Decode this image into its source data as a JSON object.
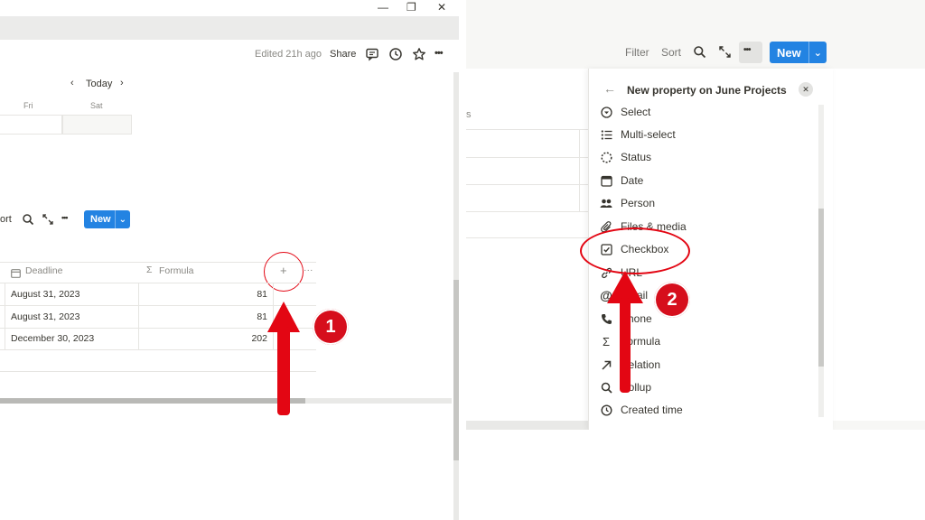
{
  "colors": {
    "accent_blue": "#2383e2",
    "annotation_red": "#e30613",
    "panel_bg": "#f7f7f5"
  },
  "left": {
    "window_controls": {
      "minimize": "—",
      "restore": "❐",
      "close": "✕"
    },
    "topbar": {
      "edited": "Edited 21h ago",
      "share": "Share",
      "icons": [
        "comment-icon",
        "clock-icon",
        "star-icon",
        "more-icon"
      ],
      "more": "•••"
    },
    "calendar": {
      "today": "Today",
      "prev": "‹",
      "next": "›",
      "days": [
        "Fri",
        "Sat"
      ]
    },
    "toolbar": {
      "sort_partial": "ort",
      "more": "•••",
      "new_label": "New",
      "chevron": "⌄"
    },
    "table": {
      "headers": {
        "deadline": "Deadline",
        "formula": "Formula",
        "formula_icon": "Σ",
        "add": "+",
        "more": "···"
      },
      "rows": [
        {
          "deadline": "August 31, 2023",
          "formula": "81"
        },
        {
          "deadline": "August 31, 2023",
          "formula": "81"
        },
        {
          "deadline": "December 30, 2023",
          "formula": "202"
        }
      ]
    },
    "annotation_number": "1"
  },
  "right": {
    "toolbar": {
      "filter": "Filter",
      "sort": "Sort",
      "more": "•••",
      "new_label": "New",
      "chevron": "⌄"
    },
    "partial_text": "s",
    "menu": {
      "back": "←",
      "title": "New property on June Projects",
      "close": "✕",
      "items": [
        {
          "label": "Select",
          "icon": "select-icon"
        },
        {
          "label": "Multi-select",
          "icon": "list-icon"
        },
        {
          "label": "Status",
          "icon": "status-icon"
        },
        {
          "label": "Date",
          "icon": "calendar-icon"
        },
        {
          "label": "Person",
          "icon": "person-icon"
        },
        {
          "label": "Files & media",
          "icon": "paperclip-icon"
        },
        {
          "label": "Checkbox",
          "icon": "checkbox-icon"
        },
        {
          "label": "URL",
          "icon": "link-icon"
        },
        {
          "label": "Email",
          "icon": "at-icon"
        },
        {
          "label": "Phone",
          "icon": "phone-icon"
        },
        {
          "label": "Formula",
          "icon": "sigma-icon"
        },
        {
          "label": "Relation",
          "icon": "arrow-up-right-icon"
        },
        {
          "label": "Rollup",
          "icon": "search-icon"
        },
        {
          "label": "Created time",
          "icon": "clock-icon"
        }
      ]
    },
    "annotation_number": "2"
  }
}
